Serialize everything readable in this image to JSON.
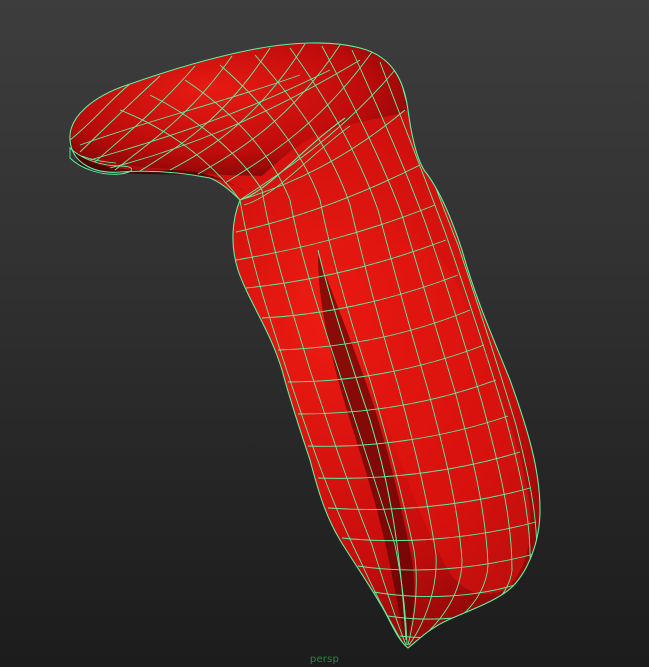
{
  "viewport": {
    "camera_name": "persp",
    "camera_label_color": "#1d8f3a",
    "background_top": "#3d3d3d",
    "background_bottom": "#1c1c1c"
  },
  "model": {
    "type": "nurbs-surface",
    "shaded_color": "#d40f0f",
    "wireframe_color": "#5cf0a0",
    "selected": true
  }
}
